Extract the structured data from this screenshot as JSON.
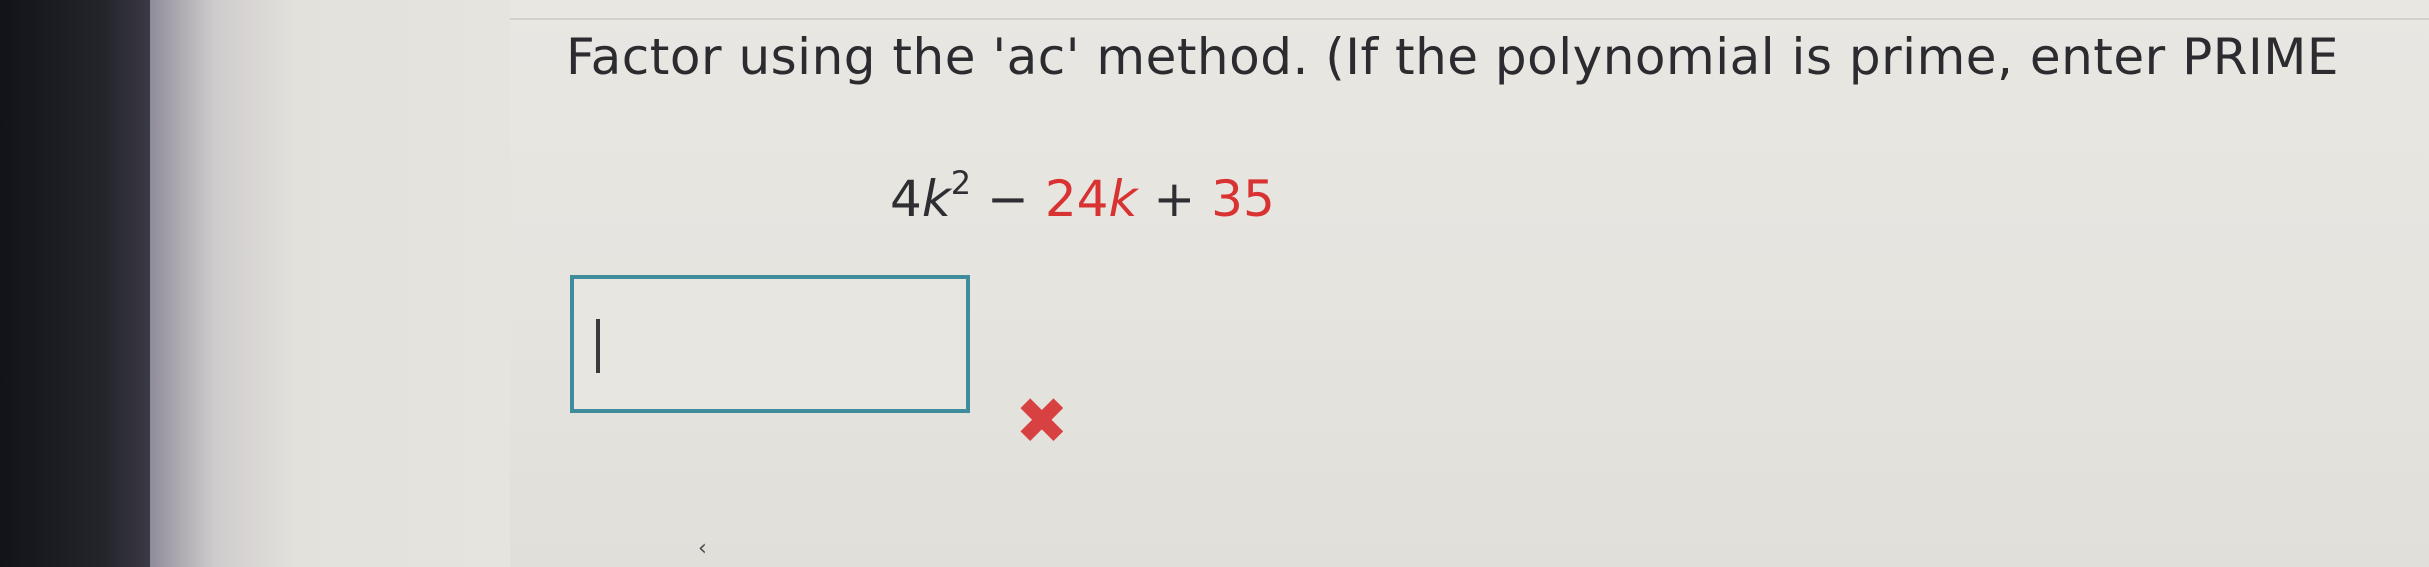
{
  "question": {
    "text": "Factor using the 'ac' method. (If the polynomial is prime, enter PRIME"
  },
  "expression": {
    "coefficient": "4",
    "variable1": "k",
    "exponent": "2",
    "operator1": "−",
    "term2": "24",
    "variable2": "k",
    "operator2": "+",
    "term3": "35"
  },
  "answer": {
    "value": "",
    "status_icon": "x-mark-icon",
    "status_color": "#d84141"
  },
  "misc": {
    "small_mark": "‹"
  }
}
